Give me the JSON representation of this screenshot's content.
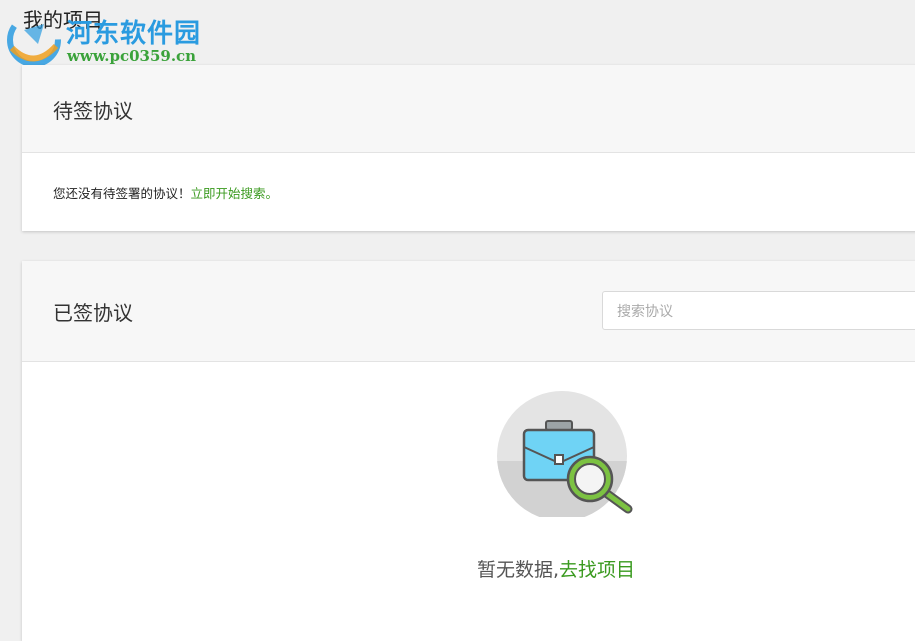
{
  "page": {
    "title": "我的项目"
  },
  "watermark": {
    "name": "河东软件园",
    "url": "www.pc0359.cn"
  },
  "pending": {
    "title": "待签协议",
    "message": "您还没有待签署的协议！",
    "link": "立即开始搜索。"
  },
  "signed": {
    "title": "已签协议",
    "search": {
      "placeholder": "搜索协议",
      "value": ""
    },
    "empty": {
      "text": "暂无数据,",
      "link": "去找项目",
      "icon": "briefcase-search-icon"
    }
  },
  "colors": {
    "link": "#3a9a1f",
    "accent_blue": "#6fd3f5",
    "accent_green": "#7cc242"
  }
}
